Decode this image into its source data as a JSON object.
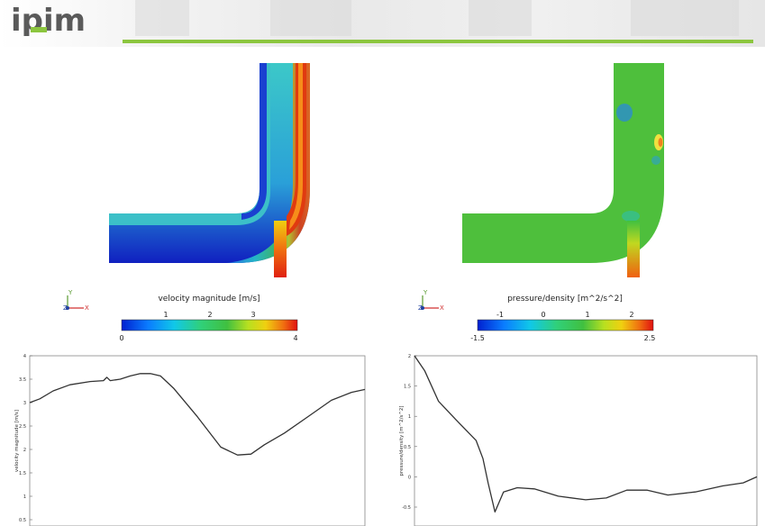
{
  "header": {
    "logo_text": "ipim",
    "brand_green": "#8cc63f",
    "brand_gray": "#5a5a5a"
  },
  "fields": {
    "velocity": {
      "colorbar_title": "velocity magnitude [m/s]",
      "ticks": [
        "1",
        "2",
        "3"
      ],
      "min_label": "0",
      "max_label": "4",
      "axes_y": "Y",
      "axes_z": "Z",
      "axes_x": "X"
    },
    "pressure": {
      "colorbar_title": "pressure/density [m^2/s^2]",
      "ticks": [
        "-1",
        "0",
        "1",
        "2"
      ],
      "min_label": "-1.5",
      "max_label": "2.5",
      "axes_y": "Y",
      "axes_z": "Z",
      "axes_x": "X"
    }
  },
  "chart_data": [
    {
      "type": "line",
      "ylabel": "velocity magnitude [m/s]",
      "xlabel": "",
      "ylim": [
        0.5,
        4
      ],
      "y_ticks": [
        "4",
        "3.5",
        "3",
        "2.5",
        "2",
        "1.5",
        "1",
        "0.5"
      ],
      "x": [
        0,
        0.03,
        0.07,
        0.12,
        0.18,
        0.22,
        0.23,
        0.24,
        0.27,
        0.3,
        0.33,
        0.36,
        0.39,
        0.43,
        0.5,
        0.57,
        0.62,
        0.66,
        0.7,
        0.76,
        0.83,
        0.9,
        0.96,
        1.0
      ],
      "series": [
        {
          "values": [
            3.0,
            3.08,
            3.25,
            3.38,
            3.45,
            3.47,
            3.54,
            3.47,
            3.5,
            3.57,
            3.62,
            3.62,
            3.57,
            3.3,
            2.7,
            2.05,
            1.88,
            1.9,
            2.1,
            2.35,
            2.7,
            3.05,
            3.22,
            3.28
          ]
        }
      ]
    },
    {
      "type": "line",
      "ylabel": "pressure/density [m^2/s^2]",
      "xlabel": "",
      "ylim": [
        -0.7,
        2
      ],
      "y_ticks": [
        "2",
        "1.5",
        "1",
        "0.5",
        "0",
        "-0.5"
      ],
      "x": [
        0,
        0.03,
        0.07,
        0.12,
        0.18,
        0.2,
        0.215,
        0.235,
        0.26,
        0.3,
        0.35,
        0.42,
        0.5,
        0.56,
        0.62,
        0.68,
        0.74,
        0.82,
        0.9,
        0.96,
        1.0
      ],
      "series": [
        {
          "values": [
            2.0,
            1.75,
            1.25,
            0.95,
            0.6,
            0.3,
            -0.1,
            -0.58,
            -0.25,
            -0.18,
            -0.2,
            -0.32,
            -0.38,
            -0.35,
            -0.22,
            -0.22,
            -0.3,
            -0.25,
            -0.15,
            -0.1,
            0.0
          ]
        }
      ]
    }
  ]
}
